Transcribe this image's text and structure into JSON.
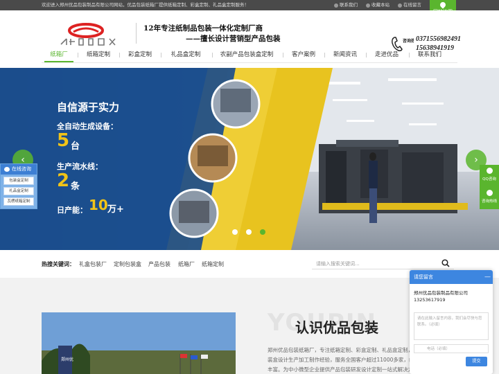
{
  "topbar": {
    "message": "欢迎进入郑州优品包装制品有限公司网站，优品包装纸箱厂提供纸箱定制、彩盒定制、礼品盒定制服务！",
    "links": [
      "联系我们",
      "收藏本站",
      "在线留言"
    ],
    "map_label": "网站地图"
  },
  "header": {
    "slogan_line1": "12年专注纸制品包装一体化定制厂商",
    "slogan_line2": "——擅长设计营销型产品包装",
    "hotline_label": "咨询热线",
    "phones": [
      "0371556982491",
      "15638941919"
    ]
  },
  "nav": {
    "items": [
      "纸箱厂",
      "纸箱定制",
      "彩盒定制",
      "礼品盒定制",
      "农副产品包装盒定制",
      "客户案例",
      "新闻资讯",
      "走进优品",
      "联系我们"
    ]
  },
  "banner": {
    "heading": "自信源于实力",
    "line1": "全自动生成设备：",
    "num1": "5",
    "unit1": "台",
    "line2": "生产流水线：",
    "num2": "2",
    "unit2": "条",
    "line3": "日产能：",
    "num3": "10",
    "unit3": "万+",
    "prev": "‹",
    "next": "›",
    "active_slide": 3
  },
  "chat_widget": {
    "title": "在线咨询",
    "buttons": [
      "包装盒定制",
      "礼品盒定制",
      "瓦楞纸箱定制"
    ]
  },
  "right_bar": [
    "QQ咨询",
    "咨询热线"
  ],
  "search": {
    "hot_label": "热搜关键词：",
    "keywords": [
      "礼盒包装厂",
      "定制包装盒",
      "产品包装",
      "纸箱厂",
      "纸箱定制"
    ],
    "placeholder": "请输入搜索关键词..."
  },
  "about": {
    "watermark": "YOUPIN",
    "title": "认识优品包装",
    "text": "郑州优品包装纸箱厂，专注纸箱定制、彩盒定制、礼品盒定制，包装盒设计生产加工制作经验，服务全国客户超过11000多家，经验丰富。为中小微型企业提供产品包装研发设计定制一站式解决方案。",
    "sign": "郑州优"
  },
  "message_box": {
    "title": "请您留言",
    "company": "郑州优品包装制品有限公司13253617919",
    "textarea_placeholder": "请在此输入留言内容，我们会尽快与您联系。（必填）",
    "phone_placeholder": "电话（必填）",
    "submit": "提交",
    "minimize": "—"
  },
  "colors": {
    "accent": "#5ab52e",
    "topbar": "#4a4a4a",
    "dialog": "#3d86e0"
  }
}
